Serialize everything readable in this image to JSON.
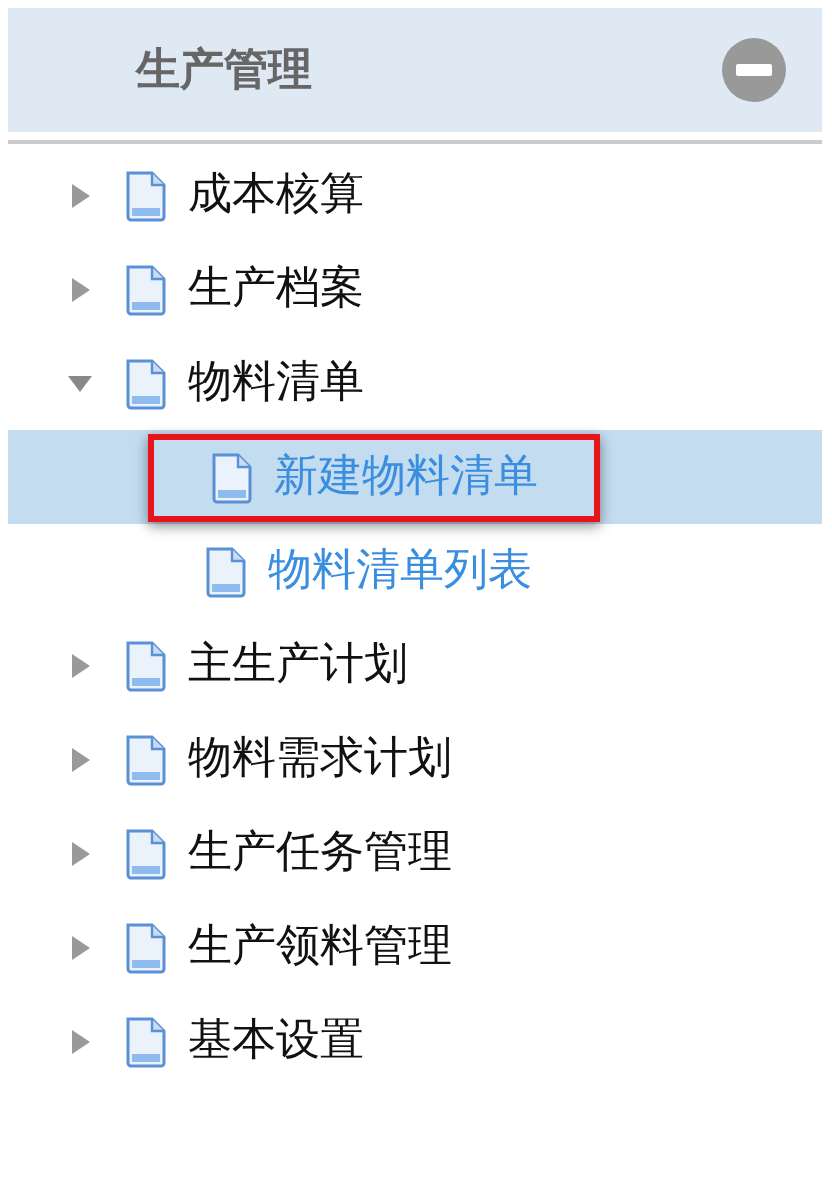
{
  "header": {
    "title": "生产管理",
    "collapsed": false
  },
  "tree": [
    {
      "label": "成本核算",
      "expanded": false
    },
    {
      "label": "生产档案",
      "expanded": false
    },
    {
      "label": "物料清单",
      "expanded": true,
      "children": [
        {
          "label": "新建物料清单",
          "selected": true,
          "highlighted": true
        },
        {
          "label": "物料清单列表",
          "selected": false,
          "highlighted": false
        }
      ]
    },
    {
      "label": "主生产计划",
      "expanded": false
    },
    {
      "label": "物料需求计划",
      "expanded": false
    },
    {
      "label": "生产任务管理",
      "expanded": false
    },
    {
      "label": "生产领料管理",
      "expanded": false
    },
    {
      "label": "基本设置",
      "expanded": false
    }
  ]
}
